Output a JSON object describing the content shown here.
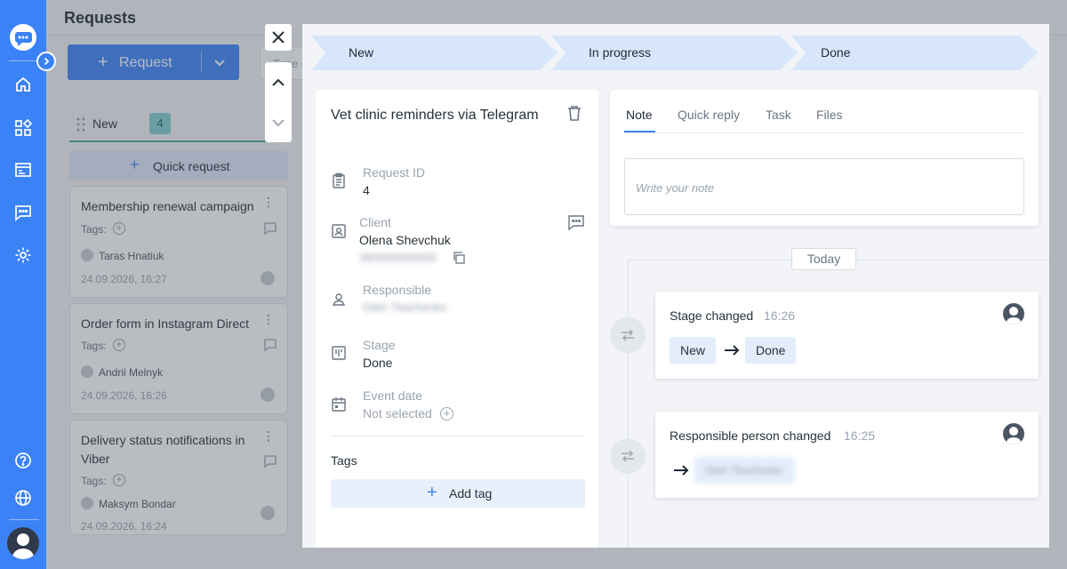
{
  "page": {
    "title": "Requests"
  },
  "toolbar": {
    "request_label": "Request",
    "search_placeholder": "Type or"
  },
  "column": {
    "name": "New",
    "count": "4",
    "quick_request": "Quick request"
  },
  "cards": [
    {
      "title": "Membership renewal campaign",
      "tags_label": "Tags:",
      "person": "Taras Hnatiuk",
      "date": "24.09.2026, 16:27"
    },
    {
      "title": "Order form in Instagram Direct",
      "tags_label": "Tags:",
      "person": "Andrii Melnyk",
      "date": "24.09.2026, 16:26"
    },
    {
      "title": "Delivery status notifications in Viber",
      "tags_label": "Tags:",
      "person": "Maksym Bondar",
      "date": "24.09.2026, 16:24"
    }
  ],
  "stages": [
    "New",
    "In progress",
    "Done"
  ],
  "request": {
    "title": "Vet clinic reminders via Telegram",
    "id_label": "Request ID",
    "id_value": "4",
    "client_label": "Client",
    "client_value": "Olena Shevchuk",
    "client_phone": "380000000000",
    "responsible_label": "Responsible",
    "responsible_value": "Oleh Tkachenko",
    "stage_label": "Stage",
    "stage_value": "Done",
    "event_label": "Event date",
    "event_value": "Not selected",
    "tags_label": "Tags",
    "add_tag_label": "Add tag"
  },
  "tabs": [
    "Note",
    "Quick reply",
    "Task",
    "Files"
  ],
  "note": {
    "placeholder": "Write your note"
  },
  "timeline": {
    "date_label": "Today",
    "events": [
      {
        "title": "Stage changed",
        "time": "16:26",
        "from": "New",
        "to": "Done"
      },
      {
        "title": "Responsible person changed",
        "time": "16:25",
        "to": "Oleh Tkachenko"
      }
    ]
  },
  "colors": {
    "sidebar": "#3b82f6",
    "primary_button": "#3b82f6",
    "stage_chip": "#d8e6fb",
    "count_badge": "#7fd1cf"
  }
}
